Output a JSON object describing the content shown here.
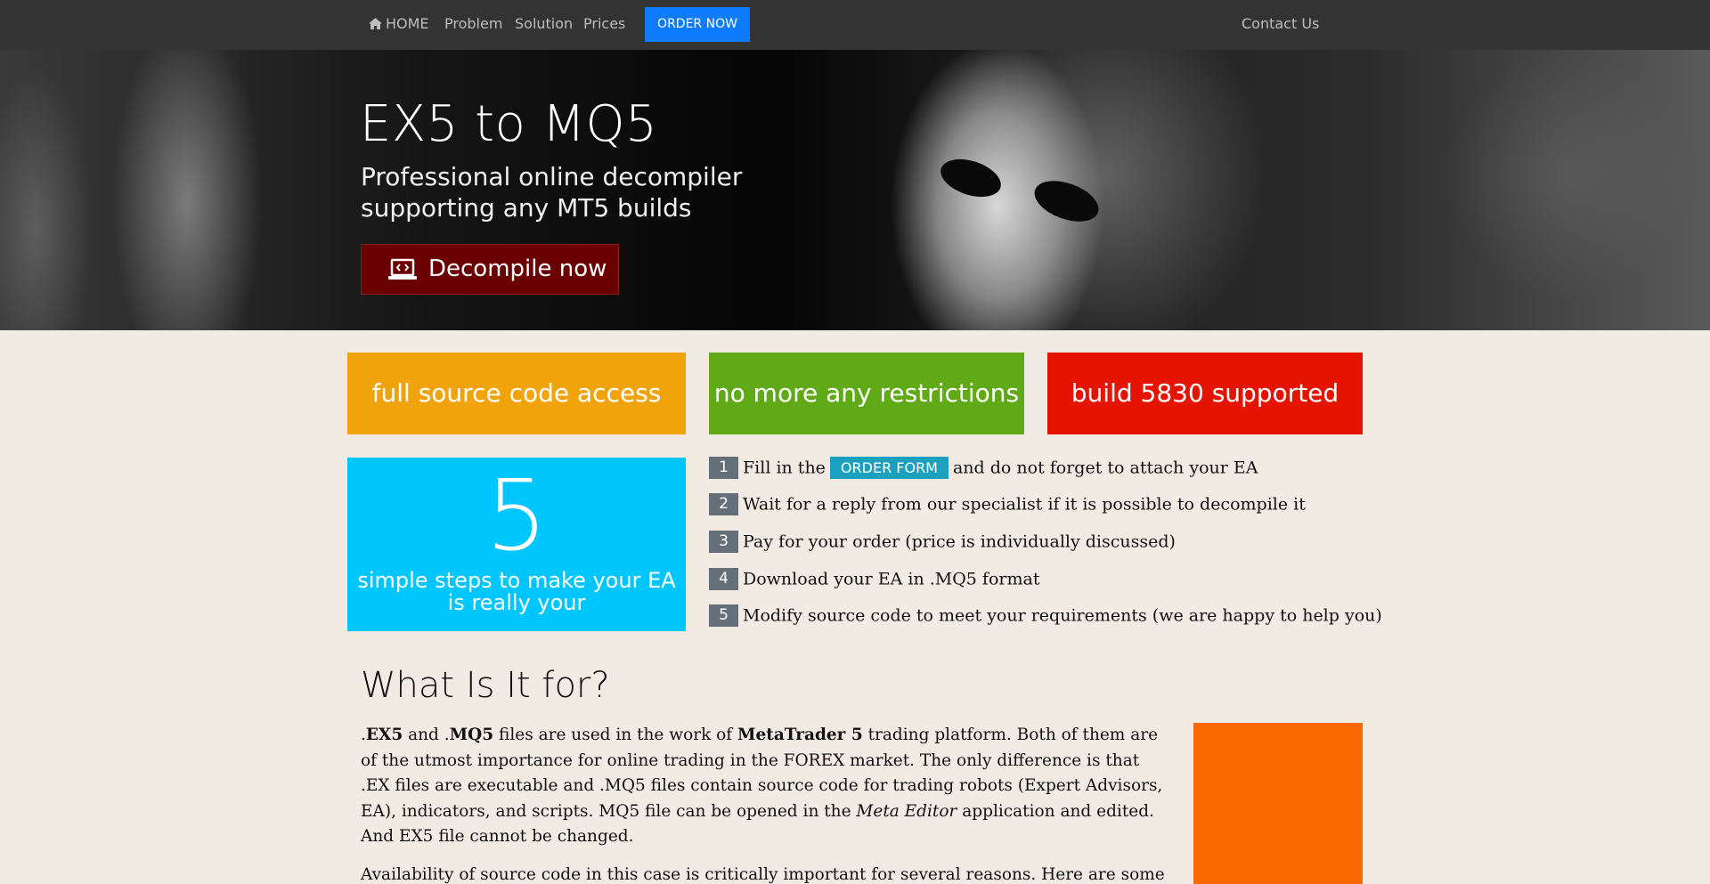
{
  "navbar": {
    "home": "HOME",
    "problem": "Problem",
    "solution": "Solution",
    "prices": "Prices",
    "order_now": "ORDER NOW",
    "contact": "Contact Us"
  },
  "hero": {
    "title": "EX5 to MQ5",
    "subtitle": "Professional online decompiler supporting any MT5 builds",
    "cta": "Decompile now"
  },
  "features": [
    {
      "label": "full source code access",
      "color": "#f0a30a"
    },
    {
      "label": "no more any restrictions",
      "color": "#60a917"
    },
    {
      "label": "build 5830 supported",
      "color": "#e51400"
    }
  ],
  "steps_box": {
    "number": "5",
    "text": "simple steps to make your EA is really your"
  },
  "steps": [
    {
      "num": "1",
      "before": "Fill in the",
      "button": "ORDER FORM",
      "after": "and do not forget to attach your EA"
    },
    {
      "num": "2",
      "text": "Wait for a reply from our specialist if it is possible to decompile it"
    },
    {
      "num": "3",
      "text": "Pay for your order (price is individually discussed)"
    },
    {
      "num": "4",
      "text": "Download your EA in .MQ5 format"
    },
    {
      "num": "5",
      "text": "Modify source code to meet your requirements (we are happy to help you)"
    }
  ],
  "section": {
    "title": "What Is It for?",
    "p1": {
      "a": ".",
      "ex5": "EX5",
      "b": " and .",
      "mq5": "MQ5",
      "c": " files are used in the work of ",
      "mt5": "MetaTrader 5",
      "d": " trading platform. Both of them are of the utmost importance for online trading in the FOREX market. The only difference is that .EX files are executable and .MQ5 files contain source code for trading robots (Expert Advisors, EA), indicators, and scripts. MQ5 file can be opened in the ",
      "editor": "Meta Editor",
      "e": " application and edited. And EX5 file cannot be changed."
    },
    "p2": "Availability of source code in this case is critically important for several reasons. Here are some of"
  },
  "colors": {
    "navbar": "#333333",
    "order_now": "#0d7cff",
    "cta": "#6a0000",
    "steps_box": "#00c6ff",
    "step_badge": "#646f7a",
    "order_form": "#1ba1bd",
    "aside_box": "#fa6800",
    "page_bg": "#f2ebe4"
  },
  "icons": [
    "home-icon",
    "laptop-code-icon"
  ]
}
